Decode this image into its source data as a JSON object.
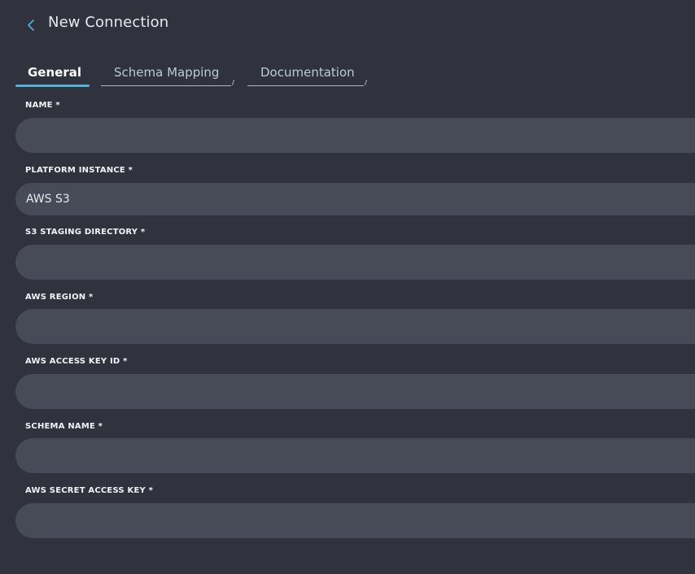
{
  "header": {
    "title": "New Connection"
  },
  "tabs": [
    {
      "label": "General",
      "active": true
    },
    {
      "label": "Schema Mapping",
      "active": false
    },
    {
      "label": "Documentation",
      "active": false
    }
  ],
  "form": {
    "fields": [
      {
        "label": "NAME *",
        "value": ""
      },
      {
        "label": "PLATFORM INSTANCE *",
        "value": "AWS S3"
      },
      {
        "label": "S3 STAGING DIRECTORY *",
        "value": ""
      },
      {
        "label": "AWS REGION *",
        "value": ""
      },
      {
        "label": "AWS ACCESS KEY ID *",
        "value": ""
      },
      {
        "label": "SCHEMA NAME *",
        "value": ""
      },
      {
        "label": "AWS SECRET ACCESS KEY *",
        "value": ""
      }
    ]
  },
  "colors": {
    "background": "#30333e",
    "input_background": "#474b57",
    "accent": "#4fb4dc"
  }
}
